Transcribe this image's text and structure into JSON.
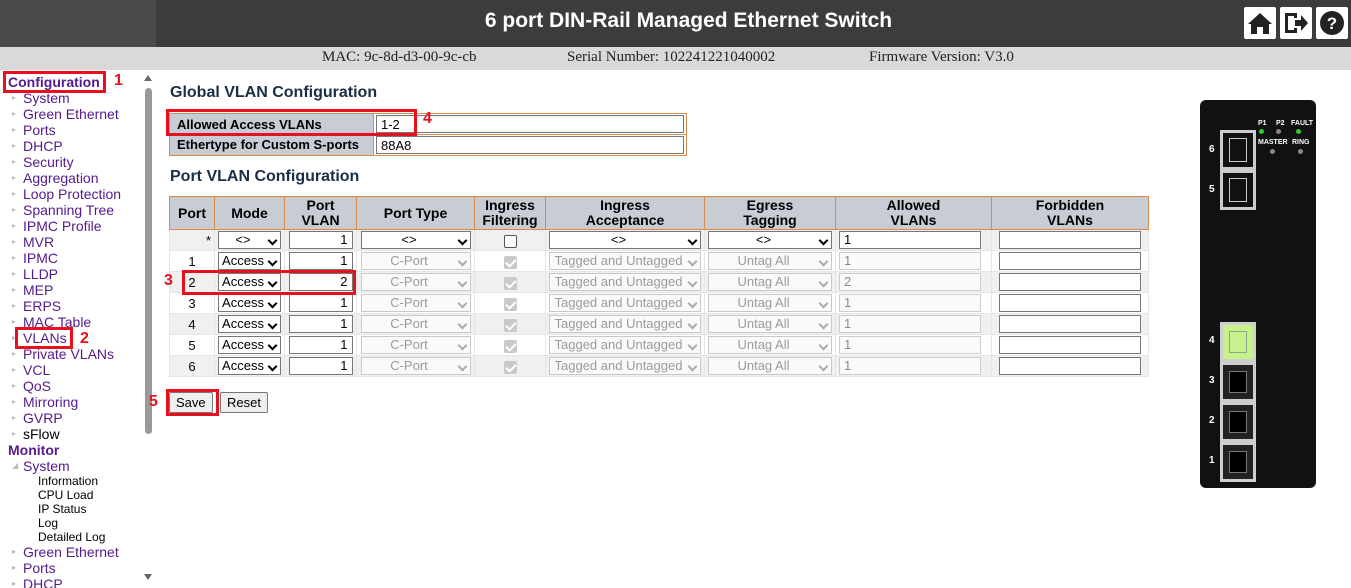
{
  "header": {
    "title": "6 port DIN-Rail Managed Ethernet Switch"
  },
  "infobar": {
    "mac": "MAC: 9c-8d-d3-00-9c-cb",
    "serial": "Serial Number: 102241221040002",
    "firmware": "Firmware Version: V3.0"
  },
  "sidebar": {
    "config_label": "Configuration",
    "config_items": [
      "System",
      "Green Ethernet",
      "Ports",
      "DHCP",
      "Security",
      "Aggregation",
      "Loop Protection",
      "Spanning Tree",
      "IPMC Profile",
      "MVR",
      "IPMC",
      "LLDP",
      "MEP",
      "ERPS",
      "MAC Table",
      "VLANs",
      "Private VLANs",
      "VCL",
      "QoS",
      "Mirroring",
      "GVRP",
      "sFlow"
    ],
    "monitor_label": "Monitor",
    "monitor_system": "System",
    "monitor_sub": [
      "Information",
      "CPU Load",
      "IP Status",
      "Log",
      "Detailed Log"
    ],
    "monitor_items": [
      "Green Ethernet",
      "Ports",
      "DHCP"
    ]
  },
  "global": {
    "title": "Global VLAN Configuration",
    "allowed_label": "Allowed Access VLANs",
    "allowed_value": "1-2",
    "ethertype_label": "Ethertype for Custom S-ports",
    "ethertype_value": "88A8"
  },
  "port_vlan": {
    "title": "Port VLAN Configuration",
    "headers": {
      "port": "Port",
      "mode": "Mode",
      "pvid_1": "Port",
      "pvid_2": "VLAN",
      "type": "Port Type",
      "ingf_1": "Ingress",
      "ingf_2": "Filtering",
      "inga_1": "Ingress",
      "inga_2": "Acceptance",
      "egt_1": "Egress",
      "egt_2": "Tagging",
      "allowed_1": "Allowed",
      "allowed_2": "VLANs",
      "forbidden_1": "Forbidden",
      "forbidden_2": "VLANs"
    },
    "wildcard": {
      "port": "*",
      "mode": "<>",
      "pvid": "1",
      "type": "<>",
      "filtering": false,
      "acceptance": "<>",
      "tagging": "<>",
      "allowed": "1",
      "forbidden": ""
    },
    "rows": [
      {
        "port": "1",
        "mode": "Access",
        "pvid": "1",
        "type": "C-Port",
        "filtering": true,
        "acceptance": "Tagged and Untagged",
        "tagging": "Untag All",
        "allowed": "1",
        "forbidden": ""
      },
      {
        "port": "2",
        "mode": "Access",
        "pvid": "2",
        "type": "C-Port",
        "filtering": true,
        "acceptance": "Tagged and Untagged",
        "tagging": "Untag All",
        "allowed": "2",
        "forbidden": ""
      },
      {
        "port": "3",
        "mode": "Access",
        "pvid": "1",
        "type": "C-Port",
        "filtering": true,
        "acceptance": "Tagged and Untagged",
        "tagging": "Untag All",
        "allowed": "1",
        "forbidden": ""
      },
      {
        "port": "4",
        "mode": "Access",
        "pvid": "1",
        "type": "C-Port",
        "filtering": true,
        "acceptance": "Tagged and Untagged",
        "tagging": "Untag All",
        "allowed": "1",
        "forbidden": ""
      },
      {
        "port": "5",
        "mode": "Access",
        "pvid": "1",
        "type": "C-Port",
        "filtering": true,
        "acceptance": "Tagged and Untagged",
        "tagging": "Untag All",
        "allowed": "1",
        "forbidden": ""
      },
      {
        "port": "6",
        "mode": "Access",
        "pvid": "1",
        "type": "C-Port",
        "filtering": true,
        "acceptance": "Tagged and Untagged",
        "tagging": "Untag All",
        "allowed": "1",
        "forbidden": ""
      }
    ]
  },
  "buttons": {
    "save": "Save",
    "reset": "Reset"
  },
  "annotations": [
    "1",
    "2",
    "3",
    "4",
    "5"
  ],
  "device": {
    "led_labels": [
      "P1",
      "P2",
      "FAULT",
      "MASTER",
      "RING"
    ],
    "port_labels": [
      "6",
      "5",
      "4",
      "3",
      "2",
      "1"
    ]
  },
  "colors": {
    "header_bg": "#3c3c3c",
    "accent_red": "#e8101f",
    "link": "#551a8b",
    "table_header": "#c8ccd4",
    "table_border": "#d88a4b",
    "active_port": "#c8f08c"
  }
}
